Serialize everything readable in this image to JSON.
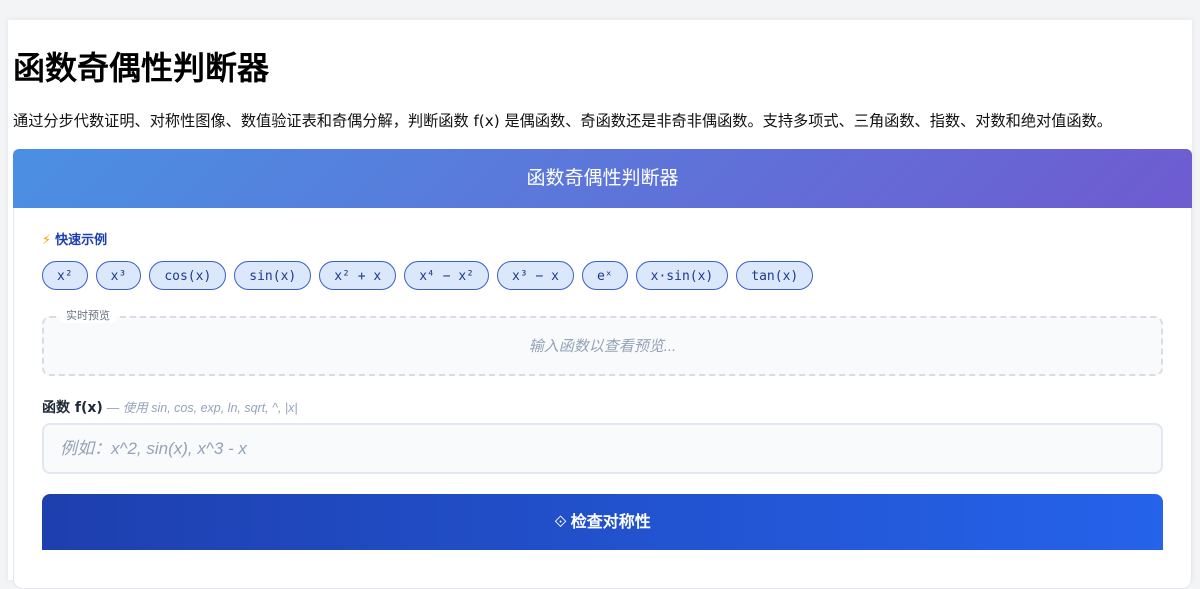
{
  "page": {
    "title": "函数奇偶性判断器",
    "description": "通过分步代数证明、对称性图像、数值验证表和奇偶分解，判断函数 f(x) 是偶函数、奇函数还是非奇非偶函数。支持多项式、三角函数、指数、对数和绝对值函数。"
  },
  "banner": {
    "title": "函数奇偶性判断器"
  },
  "quick_examples": {
    "icon": "lightning-icon",
    "icon_glyph": "⚡",
    "label": "快速示例",
    "items": [
      "x²",
      "x³",
      "cos(x)",
      "sin(x)",
      "x² + x",
      "x⁴ − x²",
      "x³ − x",
      "eˣ",
      "x·sin(x)",
      "tan(x)"
    ]
  },
  "preview": {
    "legend": "实时预览",
    "placeholder": "输入函数以查看预览..."
  },
  "function_input": {
    "label": "函数 f(x)",
    "hint": "— 使用 sin, cos, exp, ln, sqrt, ^, |x|",
    "placeholder": "例如：x^2, sin(x), x^3 - x",
    "value": ""
  },
  "check_button": {
    "icon": "diamond-icon",
    "icon_glyph": "⟐",
    "label": "检查对称性"
  },
  "colors": {
    "banner_gradient_start": "#4a90e2",
    "banner_gradient_end": "#6f5bd1",
    "button_gradient_start": "#1e3fae",
    "button_gradient_end": "#2563eb",
    "chip_background": "#dbe7fb",
    "chip_border": "#3b5fc8",
    "accent_text": "#1e40af"
  }
}
